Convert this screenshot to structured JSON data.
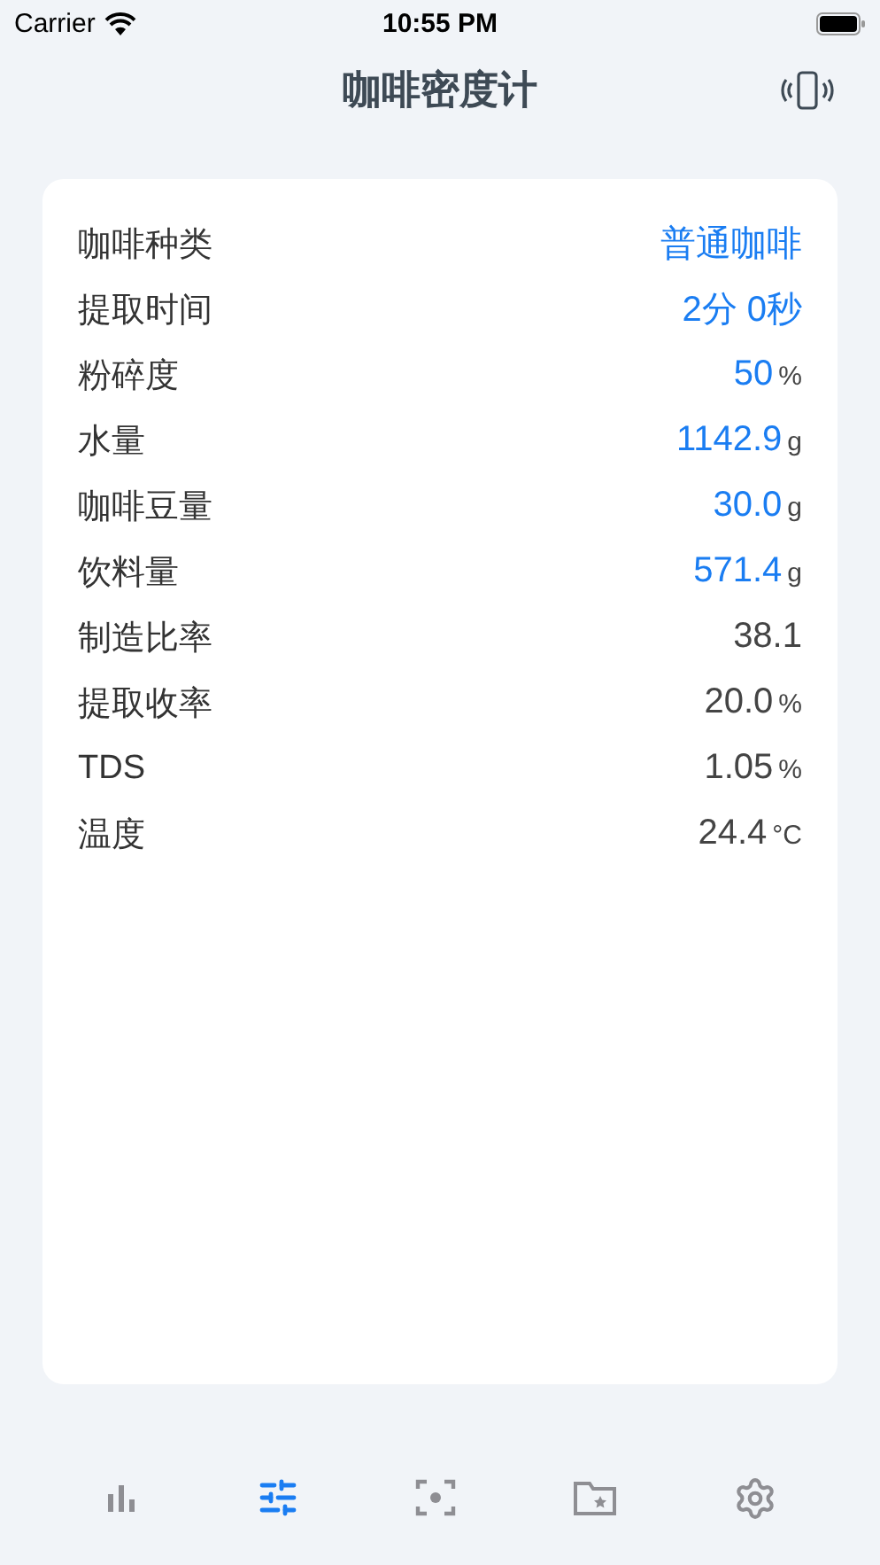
{
  "status_bar": {
    "carrier": "Carrier",
    "time": "10:55 PM"
  },
  "title": "咖啡密度计",
  "rows": [
    {
      "label": "咖啡种类",
      "value": "普通咖啡",
      "editable": true
    },
    {
      "label": "提取时间",
      "value": "2分 0秒",
      "editable": true
    },
    {
      "label": "粉碎度",
      "value": "50",
      "unit": "%",
      "editable": true
    },
    {
      "label": "水量",
      "value": "1142.9",
      "unit": "g",
      "editable": true
    },
    {
      "label": "咖啡豆量",
      "value": "30.0",
      "unit": "g",
      "editable": true
    },
    {
      "label": "饮料量",
      "value": "571.4",
      "unit": "g",
      "editable": true
    },
    {
      "label": "制造比率",
      "value": "38.1",
      "editable": false
    },
    {
      "label": "提取收率",
      "value": "20.0",
      "unit": "%",
      "editable": false
    },
    {
      "label": "TDS",
      "value": "1.05",
      "unit": "%",
      "editable": false
    },
    {
      "label": "温度",
      "value": "24.4",
      "unit": "°C",
      "editable": false
    }
  ],
  "tabs": [
    {
      "kind": "chart",
      "selected": false
    },
    {
      "kind": "sliders",
      "selected": true
    },
    {
      "kind": "scan",
      "selected": false
    },
    {
      "kind": "folder",
      "selected": false
    },
    {
      "kind": "settings",
      "selected": false
    }
  ]
}
